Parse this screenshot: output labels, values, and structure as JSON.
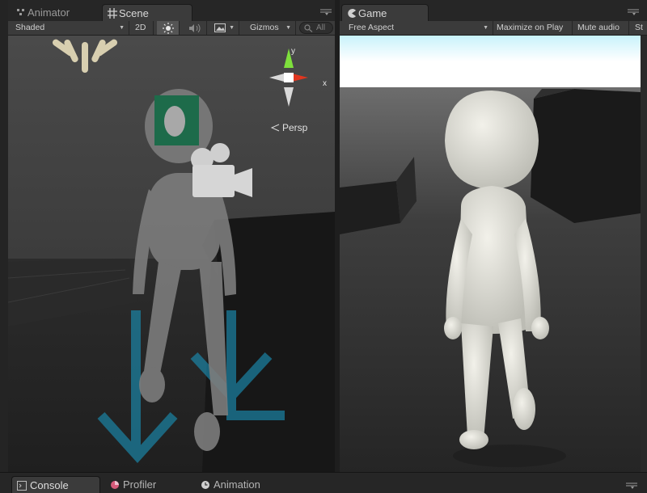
{
  "scene_panel": {
    "tabs": [
      {
        "label": "Animator",
        "icon": "animator-icon"
      },
      {
        "label": "Scene",
        "icon": "scene-grid-icon"
      }
    ],
    "toolbar": {
      "shading_mode": "Shaded",
      "mode_2d": "2D",
      "lighting_icon": "sun-icon",
      "audio_icon": "speaker-icon",
      "effects_icon": "image-icon",
      "gizmos": "Gizmos",
      "search_placeholder": "All"
    },
    "gizmo": {
      "axis_y": "y",
      "axis_x": "x",
      "projection": "Persp"
    }
  },
  "game_panel": {
    "tab": {
      "label": "Game",
      "icon": "pacman-icon"
    },
    "toolbar": {
      "aspect": "Free Aspect",
      "maximize_on_play": "Maximize on Play",
      "mute_audio": "Mute audio",
      "stats_truncated": "St"
    }
  },
  "bottom_tabs": [
    {
      "label": "Console",
      "icon": "console-icon"
    },
    {
      "label": "Profiler",
      "icon": "profiler-icon"
    },
    {
      "label": "Animation",
      "icon": "clock-icon"
    }
  ],
  "colors": {
    "panel_bg": "#3b3b3b",
    "tab_bar_bg": "#262626",
    "gizmo_y": "#7ee03c",
    "gizmo_x": "#e0361f",
    "skybox_top": "#c8f2fb",
    "arrow_blue": "#1a8cb0"
  }
}
